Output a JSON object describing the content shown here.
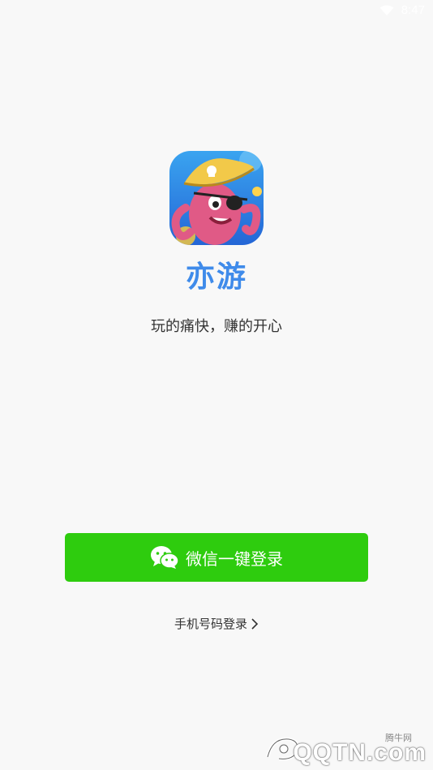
{
  "status_bar": {
    "time": "8:47",
    "wifi_icon": "wifi-icon"
  },
  "app": {
    "icon": "app-logo-octopus-pirate",
    "name": "亦游",
    "tagline": "玩的痛快，赚的开心"
  },
  "login": {
    "wechat_label": "微信一键登录",
    "wechat_icon": "wechat-icon",
    "phone_label": "手机号码登录",
    "chevron_icon": "chevron-right-icon"
  },
  "watermark": {
    "small_text": "腾牛网",
    "big_text": "QQTN.com"
  },
  "colors": {
    "background": "#f8f8f8",
    "brand_blue": "#3f8bea",
    "wechat_green": "#2ecc0e"
  }
}
